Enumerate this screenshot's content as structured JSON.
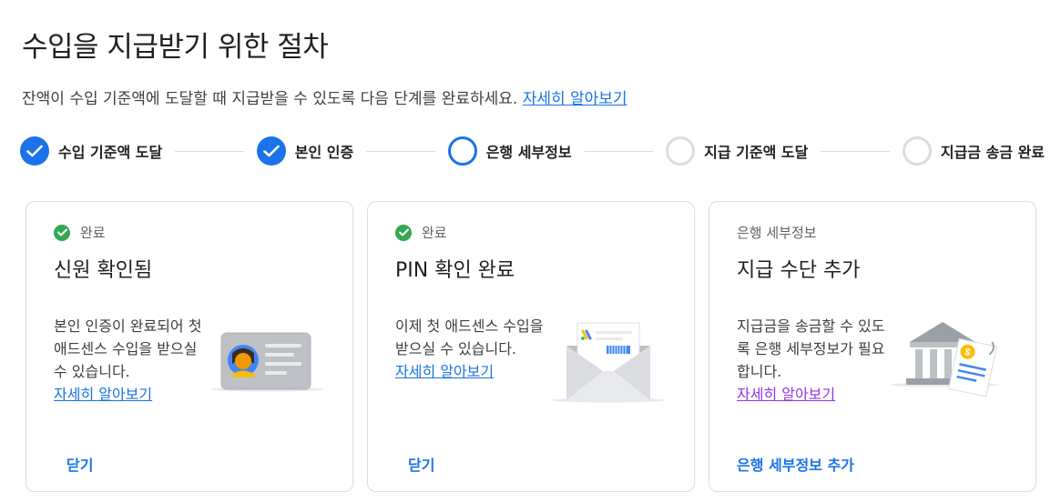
{
  "page": {
    "title": "수입을 지급받기 위한 절차",
    "subtitle": "잔액이 수입 기준액에 도달할 때 지급받을 수 있도록 다음 단계를 완료하세요.",
    "learn_more": "자세히 알아보기"
  },
  "steps": [
    {
      "label": "수입 기준액 도달",
      "state": "done"
    },
    {
      "label": "본인 인증",
      "state": "done"
    },
    {
      "label": "은행 세부정보",
      "state": "current"
    },
    {
      "label": "지급 기준액 도달",
      "state": "todo"
    },
    {
      "label": "지급금 송금 완료",
      "state": "todo"
    }
  ],
  "cards": [
    {
      "status": "완료",
      "title": "신원 확인됨",
      "description": "본인 인증이 완료되어 첫 애드센스 수입을 받으실 수 있습니다.",
      "link": "자세히 알아보기",
      "action": "닫기",
      "illustration": "id-card-icon"
    },
    {
      "status": "완료",
      "title": "PIN 확인 완료",
      "description": "이제 첫 애드센스 수입을 받으실 수 있습니다.",
      "link": "자세히 알아보기",
      "action": "닫기",
      "illustration": "envelope-icon"
    },
    {
      "status": "은행 세부정보",
      "title": "지급 수단 추가",
      "description": "지급금을 송금할 수 있도록 은행 세부정보가 필요합니다.",
      "link": "자세히 알아보기",
      "action": "은행 세부정보 추가",
      "illustration": "bank-icon"
    }
  ],
  "colors": {
    "accent": "#1a73e8",
    "success": "#34a853",
    "visited_link": "#9334e6",
    "inactive": "#dadce0"
  }
}
